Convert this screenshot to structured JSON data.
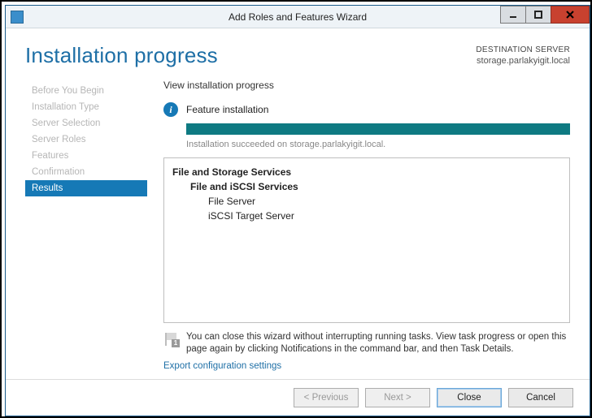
{
  "window": {
    "title": "Add Roles and Features Wizard"
  },
  "header": {
    "title": "Installation progress",
    "destination_label": "DESTINATION SERVER",
    "destination_value": "storage.parlakyigit.local"
  },
  "sidebar": {
    "items": [
      {
        "label": "Before You Begin",
        "selected": false
      },
      {
        "label": "Installation Type",
        "selected": false
      },
      {
        "label": "Server Selection",
        "selected": false
      },
      {
        "label": "Server Roles",
        "selected": false
      },
      {
        "label": "Features",
        "selected": false
      },
      {
        "label": "Confirmation",
        "selected": false
      },
      {
        "label": "Results",
        "selected": true
      }
    ]
  },
  "main": {
    "section_title": "View installation progress",
    "status_text": "Feature installation",
    "progress_caption": "Installation succeeded on storage.parlakyigit.local.",
    "results": [
      {
        "label": "File and Storage Services",
        "level": 0
      },
      {
        "label": "File and iSCSI Services",
        "level": 1
      },
      {
        "label": "File Server",
        "level": 2
      },
      {
        "label": "iSCSI Target Server",
        "level": 2
      }
    ],
    "note_text": "You can close this wizard without interrupting running tasks. View task progress or open this page again by clicking Notifications in the command bar, and then Task Details.",
    "export_link": "Export configuration settings"
  },
  "footer": {
    "previous": "< Previous",
    "next": "Next >",
    "close": "Close",
    "cancel": "Cancel"
  }
}
